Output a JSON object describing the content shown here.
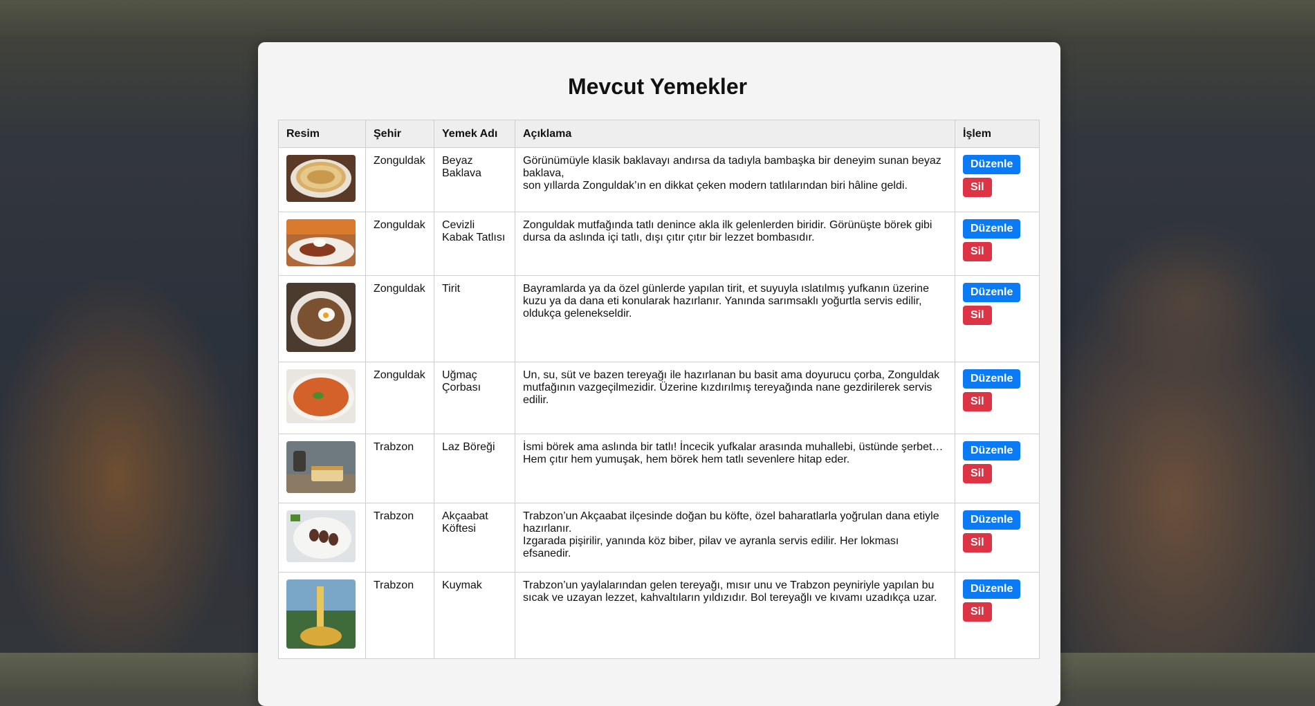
{
  "page": {
    "title": "Mevcut Yemekler"
  },
  "table": {
    "headers": {
      "image": "Resim",
      "city": "Şehir",
      "name": "Yemek Adı",
      "description": "Açıklama",
      "action": "İşlem"
    },
    "edit_label": "Düzenle",
    "delete_label": "Sil",
    "rows": [
      {
        "city": "Zonguldak",
        "name": "Beyaz Baklava",
        "desc1": "Görünümüyle klasik baklavayı andırsa da tadıyla bambaşka bir deneyim sunan beyaz baklava,",
        "desc2": "son yıllarda Zonguldak’ın en dikkat çeken modern tatlılarından biri hâline geldi.",
        "image_icon": "baklava-photo"
      },
      {
        "city": "Zonguldak",
        "name": "Cevizli Kabak Tatlısı",
        "desc1": "Zonguldak mutfağında tatlı denince akla ilk gelenlerden biridir. Görünüşte börek gibi dursa da aslında içi tatlı, dışı çıtır çıtır bir lezzet bombasıdır.",
        "desc2": "",
        "image_icon": "kabak-tatlisi-photo"
      },
      {
        "city": "Zonguldak",
        "name": "Tirit",
        "desc1": "Bayramlarda ya da özel günlerde yapılan tirit, et suyuyla ıslatılmış yufkanın üzerine kuzu ya da dana eti konularak hazırlanır. Yanında sarımsaklı yoğurtla servis edilir, oldukça gelenekseldir.",
        "desc2": "",
        "image_icon": "tirit-photo"
      },
      {
        "city": "Zonguldak",
        "name": "Uğmaç Çorbası",
        "desc1": "Un, su, süt ve bazen tereyağı ile hazırlanan bu basit ama doyurucu çorba, Zonguldak mutfağının vazgeçilmezidir. Üzerine kızdırılmış tereyağında nane gezdirilerek servis edilir.",
        "desc2": "",
        "image_icon": "corba-photo"
      },
      {
        "city": "Trabzon",
        "name": "Laz Böreği",
        "desc1": "İsmi börek ama aslında bir tatlı! İncecik yufkalar arasında muhallebi, üstünde şerbet…",
        "desc2": "Hem çıtır hem yumuşak, hem börek hem tatlı sevenlere hitap eder.",
        "image_icon": "laz-boregi-photo"
      },
      {
        "city": "Trabzon",
        "name": "Akçaabat Köftesi",
        "desc1": "Trabzon’un Akçaabat ilçesinde doğan bu köfte, özel baharatlarla yoğrulan dana etiyle hazırlanır.",
        "desc2": "Izgarada pişirilir, yanında köz biber, pilav ve ayranla servis edilir. Her lokması efsanedir.",
        "image_icon": "kofte-photo"
      },
      {
        "city": "Trabzon",
        "name": "Kuymak",
        "desc1": "Trabzon’un yaylalarından gelen tereyağı, mısır unu ve Trabzon peyniriyle yapılan bu sıcak ve uzayan lezzet, kahvaltıların yıldızıdır. Bol tereyağlı ve kıvamı uzadıkça uzar.",
        "desc2": "",
        "image_icon": "kuymak-photo"
      }
    ]
  }
}
